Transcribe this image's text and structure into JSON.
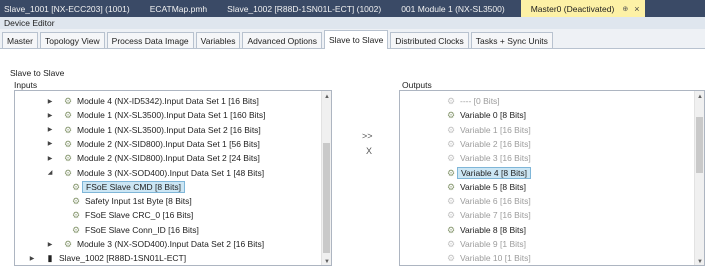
{
  "doc_tabs": [
    {
      "label": "Slave_1001 [NX-ECC203] (1001)"
    },
    {
      "label": "ECATMap.pmh"
    },
    {
      "label": "Slave_1002 [R88D-1SN01L-ECT] (1002)"
    },
    {
      "label": "001 Module 1 (NX-SL3500)"
    },
    {
      "label": "Master0 (Deactivated)",
      "pin": "⊕",
      "close": "×"
    }
  ],
  "editor_title": "Device Editor",
  "tabs": [
    "Master",
    "Topology View",
    "Process Data Image",
    "Variables",
    "Advanced Options",
    "Slave to Slave",
    "Distributed Clocks",
    "Tasks + Sync Units"
  ],
  "active_tab": "Slave to Slave",
  "section_title": "Slave to Slave",
  "inputs_label": "Inputs",
  "outputs_label": "Outputs",
  "transfer": {
    "add": ">>",
    "remove": "X"
  },
  "inputs": [
    {
      "label": "Module 4 (NX-ID5342).Input Data Set 1 [16 Bits]",
      "level": 1,
      "expander": "▶",
      "icon": "module-icon"
    },
    {
      "label": "Module 1 (NX-SL3500).Input Data Set 1 [160 Bits]",
      "level": 1,
      "expander": "▶",
      "icon": "module-icon"
    },
    {
      "label": "Module 1 (NX-SL3500).Input Data Set 2 [16 Bits]",
      "level": 1,
      "expander": "▶",
      "icon": "module-icon"
    },
    {
      "label": "Module 2 (NX-SID800).Input Data Set 1 [56 Bits]",
      "level": 1,
      "expander": "▶",
      "icon": "module-icon"
    },
    {
      "label": "Module 2 (NX-SID800).Input Data Set 2 [24 Bits]",
      "level": 1,
      "expander": "▶",
      "icon": "module-icon"
    },
    {
      "label": "Module 3 (NX-SOD400).Input Data Set 1 [48 Bits]",
      "level": 1,
      "expander": "◢",
      "icon": "module-icon"
    },
    {
      "label": "FSoE Slave CMD [8 Bits]",
      "level": 2,
      "expander": "",
      "icon": "variable-icon",
      "selected": true
    },
    {
      "label": "Safety Input 1st Byte [8 Bits]",
      "level": 2,
      "expander": "",
      "icon": "variable-icon"
    },
    {
      "label": "FSoE Slave CRC_0 [16 Bits]",
      "level": 2,
      "expander": "",
      "icon": "variable-icon"
    },
    {
      "label": "FSoE Slave Conn_ID [16 Bits]",
      "level": 2,
      "expander": "",
      "icon": "variable-icon"
    },
    {
      "label": "Module 3 (NX-SOD400).Input Data Set 2 [16 Bits]",
      "level": 1,
      "expander": "▶",
      "icon": "module-icon"
    },
    {
      "label": "Slave_1002 [R88D-1SN01L-ECT]",
      "level": 0,
      "expander": "▶",
      "icon": "slave-icon"
    }
  ],
  "outputs": [
    {
      "label": "---- [0 Bits]",
      "dim": true
    },
    {
      "label": "Variable 0 [8 Bits]",
      "dim": false
    },
    {
      "label": "Variable 1 [16 Bits]",
      "dim": true
    },
    {
      "label": "Variable 2 [16 Bits]",
      "dim": true
    },
    {
      "label": "Variable 3 [16 Bits]",
      "dim": true
    },
    {
      "label": "Variable 4 [8 Bits]",
      "dim": false,
      "selected": true
    },
    {
      "label": "Variable 5 [8 Bits]",
      "dim": false
    },
    {
      "label": "Variable 6 [16 Bits]",
      "dim": true
    },
    {
      "label": "Variable 7 [16 Bits]",
      "dim": true
    },
    {
      "label": "Variable 8 [8 Bits]",
      "dim": false
    },
    {
      "label": "Variable 9 [1 Bits]",
      "dim": true
    },
    {
      "label": "Variable 10 [1 Bits]",
      "dim": true
    }
  ],
  "colors": {
    "doc_tab_bar": "#3a4a66",
    "active_doc_tab": "#fdf1a6",
    "selection": "#cce6f4"
  }
}
